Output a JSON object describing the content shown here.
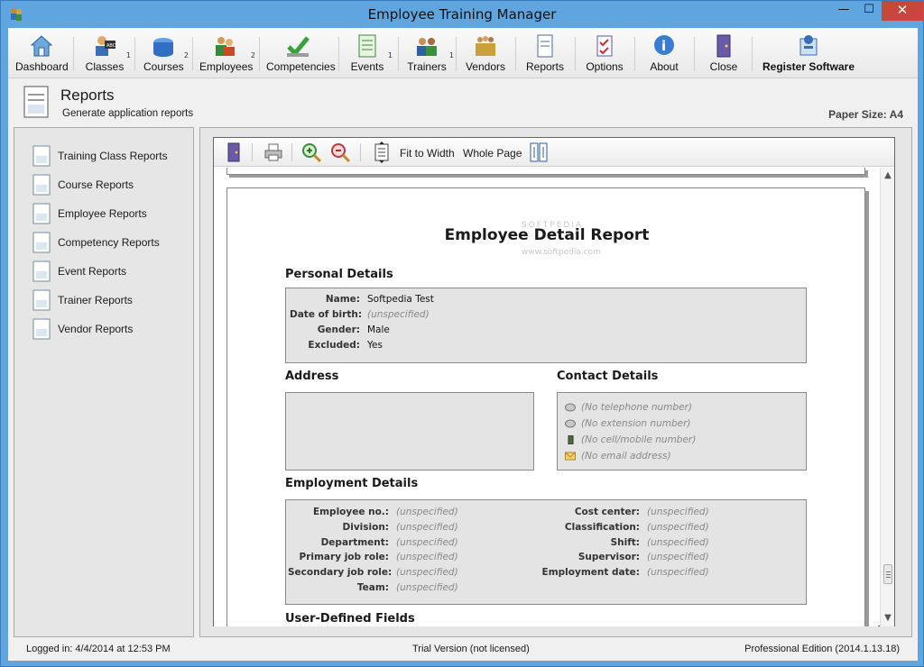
{
  "window": {
    "title": "Employee Training Manager",
    "minimize": "—",
    "maximize": "☐",
    "close": "✕"
  },
  "toolbar": {
    "items": [
      {
        "label": "Dashboard",
        "icon": "house-icon",
        "count": ""
      },
      {
        "label": "Classes",
        "icon": "class-icon",
        "count": "1"
      },
      {
        "label": "Courses",
        "icon": "courses-icon",
        "count": "2"
      },
      {
        "label": "Employees",
        "icon": "employees-icon",
        "count": "2"
      },
      {
        "label": "Competencies",
        "icon": "checkmark-icon",
        "count": ""
      },
      {
        "label": "Events",
        "icon": "events-icon",
        "count": "1"
      },
      {
        "label": "Trainers",
        "icon": "trainers-icon",
        "count": "1"
      },
      {
        "label": "Vendors",
        "icon": "vendors-icon",
        "count": ""
      },
      {
        "label": "Reports",
        "icon": "report-icon",
        "count": ""
      },
      {
        "label": "Options",
        "icon": "options-icon",
        "count": ""
      },
      {
        "label": "About",
        "icon": "info-icon",
        "count": ""
      },
      {
        "label": "Close",
        "icon": "door-icon",
        "count": ""
      },
      {
        "label": "Register Software",
        "icon": "register-icon",
        "count": ""
      }
    ]
  },
  "header": {
    "title": "Reports",
    "subtitle": "Generate application reports",
    "paper_size": "Paper Size: A4"
  },
  "sidebar": {
    "items": [
      {
        "label": "Training Class Reports"
      },
      {
        "label": "Course Reports"
      },
      {
        "label": "Employee Reports"
      },
      {
        "label": "Competency Reports"
      },
      {
        "label": "Event Reports"
      },
      {
        "label": "Trainer Reports"
      },
      {
        "label": "Vendor Reports"
      }
    ]
  },
  "viewer_toolbar": {
    "fit_width": "Fit to Width",
    "whole_page": "Whole Page"
  },
  "report": {
    "title": "Employee Detail Report",
    "watermark": "SOFTPEDIA",
    "watermark_url": "www.softpedia.com",
    "personal": {
      "heading": "Personal Details",
      "rows": [
        {
          "key": "Name:",
          "value": "Softpedia Test",
          "unspecified": false
        },
        {
          "key": "Date of birth:",
          "value": "(unspecified)",
          "unspecified": true
        },
        {
          "key": "Gender:",
          "value": "Male",
          "unspecified": false
        },
        {
          "key": "Excluded:",
          "value": "Yes",
          "unspecified": false
        }
      ]
    },
    "address": {
      "heading": "Address"
    },
    "contact": {
      "heading": "Contact Details",
      "rows": [
        {
          "icon": "phone-icon",
          "value": "(No telephone number)"
        },
        {
          "icon": "phone-extension-icon",
          "value": "(No extension number)"
        },
        {
          "icon": "mobile-phone-icon",
          "value": "(No cell/mobile number)"
        },
        {
          "icon": "envelope-icon",
          "value": "(No email address)"
        }
      ]
    },
    "employment": {
      "heading": "Employment Details",
      "left": [
        {
          "key": "Employee no.:",
          "value": "(unspecified)"
        },
        {
          "key": "Division:",
          "value": "(unspecified)"
        },
        {
          "key": "Department:",
          "value": "(unspecified)"
        },
        {
          "key": "Primary job role:",
          "value": "(unspecified)"
        },
        {
          "key": "Secondary job role:",
          "value": "(unspecified)"
        },
        {
          "key": "Team:",
          "value": "(unspecified)"
        }
      ],
      "right": [
        {
          "key": "Cost center:",
          "value": "(unspecified)"
        },
        {
          "key": "Classification:",
          "value": "(unspecified)"
        },
        {
          "key": "Shift:",
          "value": "(unspecified)"
        },
        {
          "key": "Supervisor:",
          "value": "(unspecified)"
        },
        {
          "key": "Employment date:",
          "value": "(unspecified)"
        }
      ]
    },
    "user_defined": {
      "heading": "User-Defined Fields"
    }
  },
  "status": {
    "logged_in": "Logged in:  4/4/2014 at 12:53 PM",
    "license": "Trial Version (not licensed)",
    "edition": "Professional Edition (2014.1.13.18)"
  }
}
